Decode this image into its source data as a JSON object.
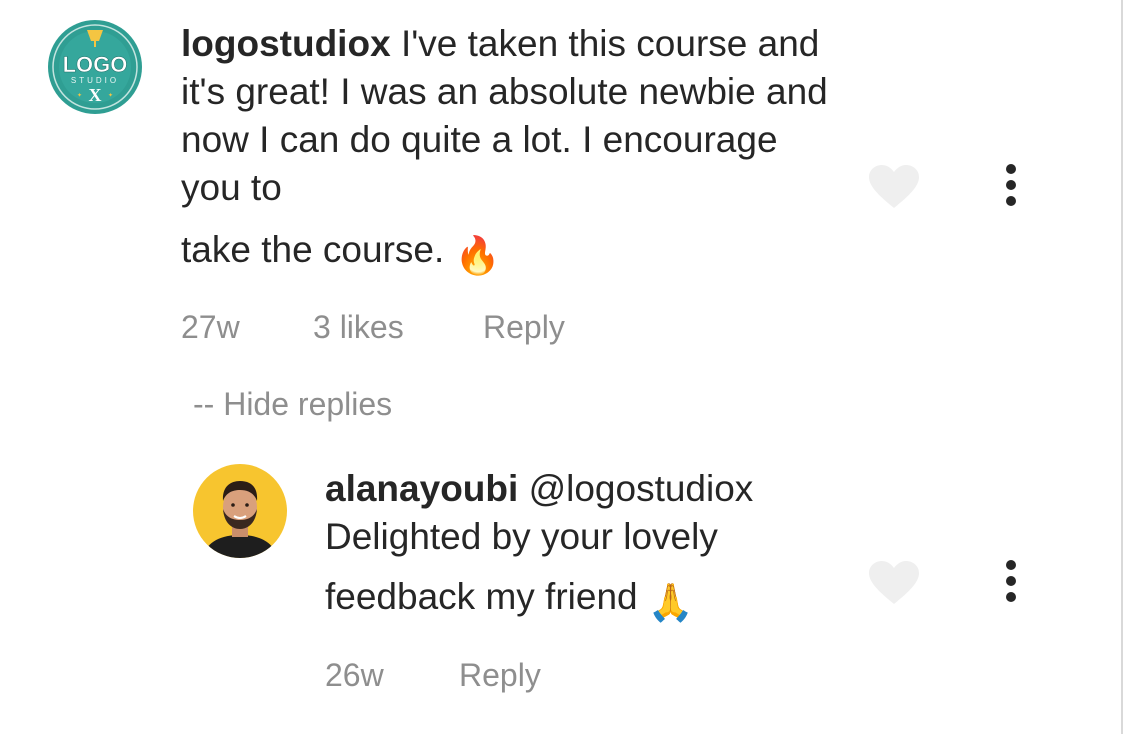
{
  "comment": {
    "username": "logostudiox",
    "text_part1": "I've taken this course and it's great! I was an absolute newbie and now I can do quite a lot. I encourage you to",
    "text_part2": "take the course.",
    "emoji": "🔥",
    "time": "27w",
    "likes": "3 likes",
    "reply_label": "Reply",
    "avatar_logo": {
      "text": "LOGO",
      "subtext": "STUDIO",
      "letter": "X",
      "color": "#2a9d8f"
    }
  },
  "hide_replies_label": "-- Hide replies",
  "reply": {
    "username": "alanayoubi",
    "mention": "@logostudiox",
    "text_part1": "Delighted by your lovely",
    "text_part2": "feedback my friend",
    "emoji": "🙏",
    "time": "26w",
    "reply_label": "Reply",
    "avatar_bg": "#f7c52f"
  },
  "icons": {
    "like": "heart-icon",
    "more": "more-vertical-icon"
  },
  "colors": {
    "text": "#262626",
    "muted": "#8e8e8e",
    "heart": "#efefef"
  }
}
